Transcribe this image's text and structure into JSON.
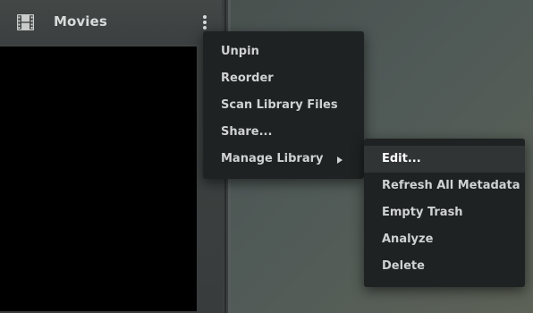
{
  "library": {
    "icon": "film-icon",
    "title": "Movies",
    "more_icon": "kebab-menu-icon"
  },
  "menu": {
    "items": [
      {
        "label": "Unpin"
      },
      {
        "label": "Reorder"
      },
      {
        "label": "Scan Library Files"
      },
      {
        "label": "Share..."
      },
      {
        "label": "Manage Library",
        "submenu_icon": "chevron-right-icon"
      }
    ]
  },
  "submenu": {
    "items": [
      {
        "label": "Edit...",
        "active": true
      },
      {
        "label": "Refresh All Metadata"
      },
      {
        "label": "Empty Trash"
      },
      {
        "label": "Analyze"
      },
      {
        "label": "Delete"
      }
    ]
  },
  "colors": {
    "menu_bg": "#1f2222",
    "menu_text": "#cfd2d1",
    "active_item_bg": "#303434",
    "poster_bg": "#000000"
  }
}
